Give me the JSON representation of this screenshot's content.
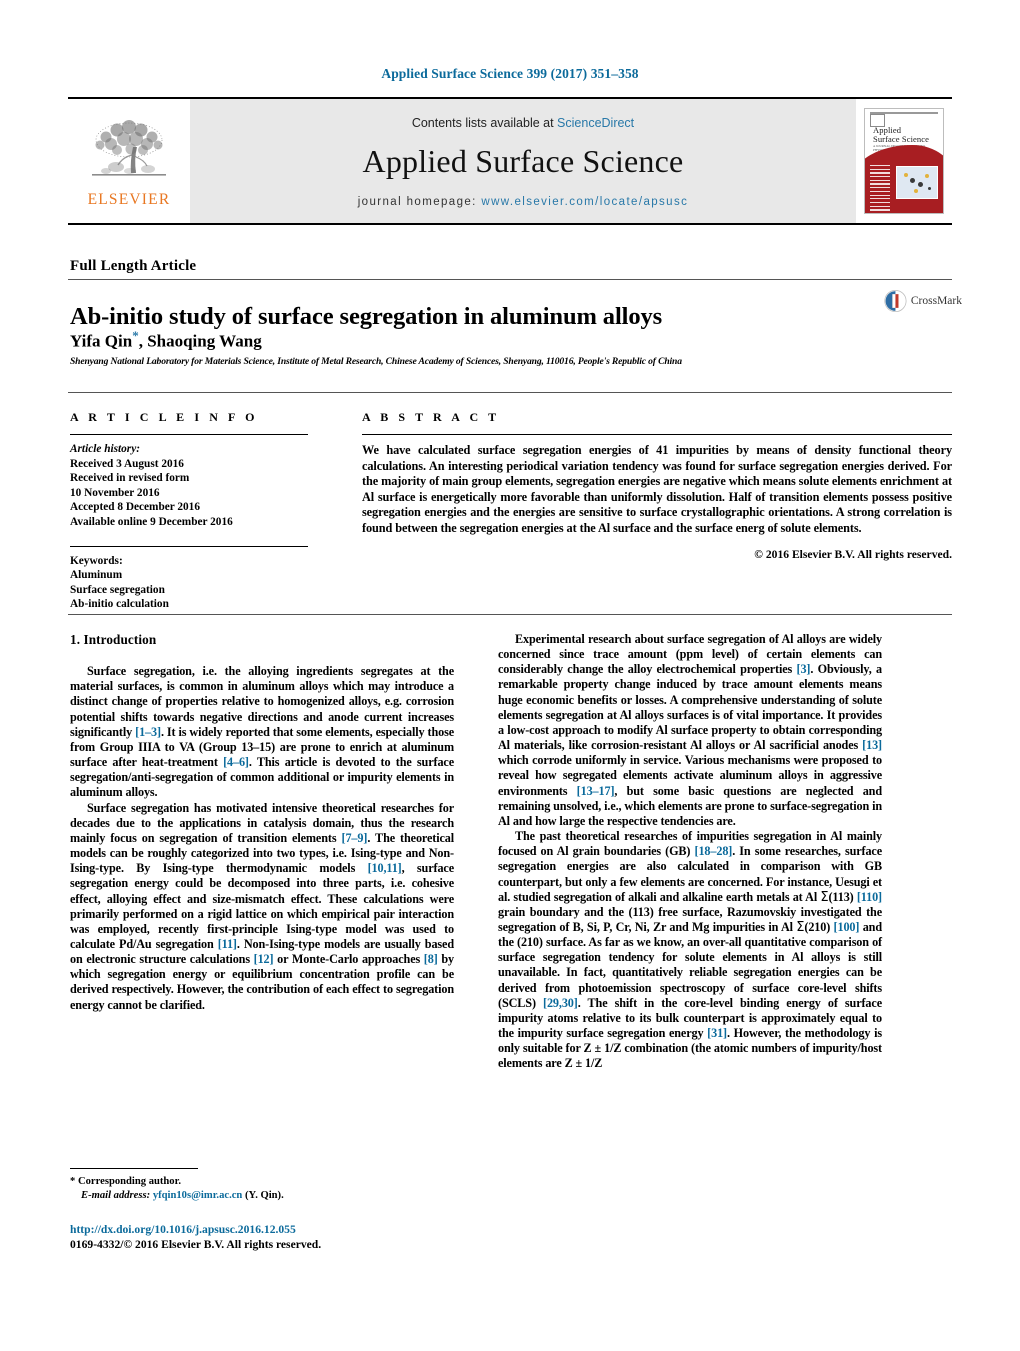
{
  "running_head": "Applied Surface Science 399 (2017) 351–358",
  "masthead": {
    "publisher_name": "ELSEVIER",
    "contents_prefix": "Contents lists available at ",
    "contents_link": "ScienceDirect",
    "journal_title": "Applied Surface Science",
    "homepage_prefix": "journal homepage: ",
    "homepage_url": "www.elsevier.com/locate/apsusc",
    "cover": {
      "title_line1": "Applied",
      "title_line2": "Surface Science",
      "subtitle": "A JOURNAL DEVOTED TO APPLIED PHYSICS AND CHEMISTRY OF SURFACES AND INTERFACES",
      "volume_note": "VOLUME 399 / 15 JANUARY 2017"
    }
  },
  "article": {
    "type": "Full Length Article",
    "title": "Ab-initio study of surface segregation in aluminum alloys",
    "authors": "Yifa Qin",
    "corresponding_marker": "*",
    "authors_rest": ", Shaoqing Wang",
    "affiliation": "Shenyang National Laboratory for Materials Science, Institute of Metal Research, Chinese Academy of Sciences, Shenyang, 110016, People's Republic of China",
    "crossmark_label": "CrossMark"
  },
  "article_info": {
    "heading": "A R T I C L E   I N F O",
    "history_label": "Article history:",
    "history": [
      "Received 3 August 2016",
      "Received in revised form",
      "10 November 2016",
      "Accepted 8 December 2016",
      "Available online 9 December 2016"
    ],
    "keywords_label": "Keywords:",
    "keywords": [
      "Aluminum",
      "Surface segregation",
      "Ab-initio calculation"
    ]
  },
  "abstract": {
    "heading": "A B S T R A C T",
    "text": "We have calculated surface segregation energies of 41 impurities by means of density functional theory calculations. An interesting periodical variation tendency was found for surface segregation energies derived. For the majority of main group elements, segregation energies are negative which means solute elements enrichment at Al surface is energetically more favorable than uniformly dissolution. Half of transition elements possess positive segregation energies and the energies are sensitive to surface crystallographic orientations. A strong correlation is found between the segregation energies at the Al surface and the surface energ of solute elements.",
    "copyright": "© 2016 Elsevier B.V. All rights reserved."
  },
  "body": {
    "intro_heading": "1.  Introduction",
    "left_paragraphs": [
      "Surface segregation, i.e. the alloying ingredients segregates at the material surfaces, is common in aluminum alloys which may introduce a distinct change of properties relative to homogenized alloys, e.g. corrosion potential shifts towards negative directions and anode current increases significantly [1–3]. It is widely reported that some elements, especially those from Group IIIA to VA (Group 13–15) are prone to enrich at aluminum surface after heat-treatment [4–6]. This article is devoted to the surface segregation/anti-segregation of common additional or impurity elements in aluminum alloys.",
      "Surface segregation has motivated intensive theoretical researches for decades due to the applications in catalysis domain, thus the research mainly focus on segregation of transition elements [7–9]. The theoretical models can be roughly categorized into two types, i.e. Ising-type and Non-Ising-type. By Ising-type thermodynamic models [10,11], surface segregation energy could be decomposed into three parts, i.e. cohesive effect, alloying effect and size-mismatch effect. These calculations were primarily performed on a rigid lattice on which empirical pair interaction was employed, recently first-principle Ising-type model was used to calculate Pd/Au segregation [11]. Non-Ising-type models are usually based on electronic structure calculations [12] or Monte-Carlo approaches [8] by which segregation energy or equilibrium concentration profile can be derived respectively. However, the contribution of each effect to segregation energy cannot be clarified."
    ],
    "right_paragraphs": [
      "Experimental research about surface segregation of Al alloys are widely concerned since trace amount (ppm level) of certain elements can considerably change the alloy electrochemical properties [3]. Obviously, a remarkable property change induced by trace amount elements means huge economic benefits or losses. A comprehensive understanding of solute elements segregation at Al alloys surfaces is of vital importance. It provides a low-cost approach to modify Al surface property to obtain corresponding Al materials, like corrosion-resistant Al alloys or Al sacrificial anodes [13] which corrode uniformly in service. Various mechanisms were proposed to reveal how segregated elements activate aluminum alloys in aggressive environments [13–17], but some basic questions are neglected and remaining unsolved, i.e., which elements are prone to surface-segregation in Al and how large the respective tendencies are.",
      "The past theoretical researches of impurities segregation in Al mainly focused on Al grain boundaries (GB) [18–28]. In some researches, surface segregation energies are also calculated in comparison with GB counterpart, but only a few elements are concerned. For instance, Uesugi et al. studied segregation of alkali and alkaline earth metals at Al Σ(113) [110] grain boundary and the (113) free surface, Razumovskiy investigated the segregation of B, Si, P, Cr, Ni, Zr and Mg impurities in Al Σ(210) [100] and the (210) surface. As far as we know, an over-all quantitative comparison of surface segregation tendency for solute elements in Al alloys is still unavailable. In fact, quantitatively reliable segregation energies can be derived from photoemission spectroscopy of surface core-level shifts (SCLS) [29,30]. The shift in the core-level binding energy of surface impurity atoms relative to its bulk counterpart is approximately equal to the impurity surface segregation energy [31]. However, the methodology is only suitable for Z ± 1/Z combination (the atomic numbers of impurity/host elements are Z ± 1/Z"
    ]
  },
  "footer": {
    "corresponding_marker": "*",
    "corresponding_text": "Corresponding author.",
    "email_label": "E-mail address:",
    "email": "yfqin10s@imr.ac.cn",
    "email_suffix": "(Y. Qin).",
    "doi_url": "http://dx.doi.org/10.1016/j.apsusc.2016.12.055",
    "issn_line": "0169-4332/© 2016 Elsevier B.V. All rights reserved."
  },
  "colors": {
    "link_blue": "#0b6a9b",
    "elsevier_orange": "#E87722",
    "cover_red": "#a81e22",
    "band_gray": "#e8e8e8"
  }
}
